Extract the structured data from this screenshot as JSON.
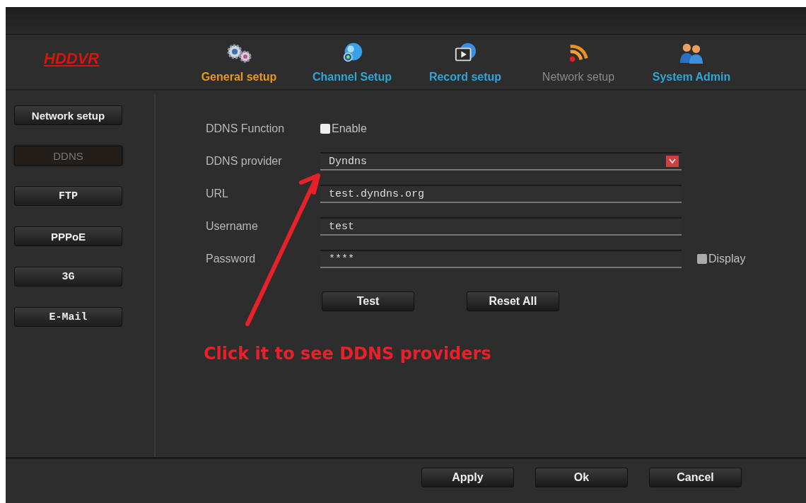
{
  "logo": "HDDVR",
  "tabs": [
    {
      "label": "General setup",
      "selected": true,
      "disabled": false
    },
    {
      "label": "Channel Setup",
      "selected": false,
      "disabled": false
    },
    {
      "label": "Record setup",
      "selected": false,
      "disabled": false
    },
    {
      "label": "Network setup",
      "selected": false,
      "disabled": true
    },
    {
      "label": "System Admin",
      "selected": false,
      "disabled": false
    }
  ],
  "sidebar": {
    "items": [
      {
        "label": "Network setup",
        "selected": false,
        "kind": "sans"
      },
      {
        "label": "DDNS",
        "selected": true,
        "kind": "sans"
      },
      {
        "label": "FTP",
        "selected": false,
        "kind": "mono"
      },
      {
        "label": "PPPoE",
        "selected": false,
        "kind": "sans"
      },
      {
        "label": "3G",
        "selected": false,
        "kind": "mono"
      },
      {
        "label": "E-Mail",
        "selected": false,
        "kind": "mono"
      }
    ]
  },
  "form": {
    "rows": [
      {
        "kind": "checkbox",
        "label": "DDNS Function",
        "option": "Enable",
        "checked": false
      },
      {
        "kind": "dropdown",
        "label": "DDNS provider",
        "value": "Dyndns"
      },
      {
        "kind": "text",
        "label": "URL",
        "value": "test.dyndns.org"
      },
      {
        "kind": "text",
        "label": "Username",
        "value": "test"
      },
      {
        "kind": "text",
        "label": "Password",
        "value": "****",
        "option": "Display",
        "checked": false
      }
    ],
    "buttons": [
      "Test",
      "Reset All"
    ]
  },
  "annotation": {
    "text": "Click it to see DDNS providers"
  },
  "footer": {
    "buttons": [
      "Apply",
      "Ok",
      "Cancel"
    ]
  }
}
